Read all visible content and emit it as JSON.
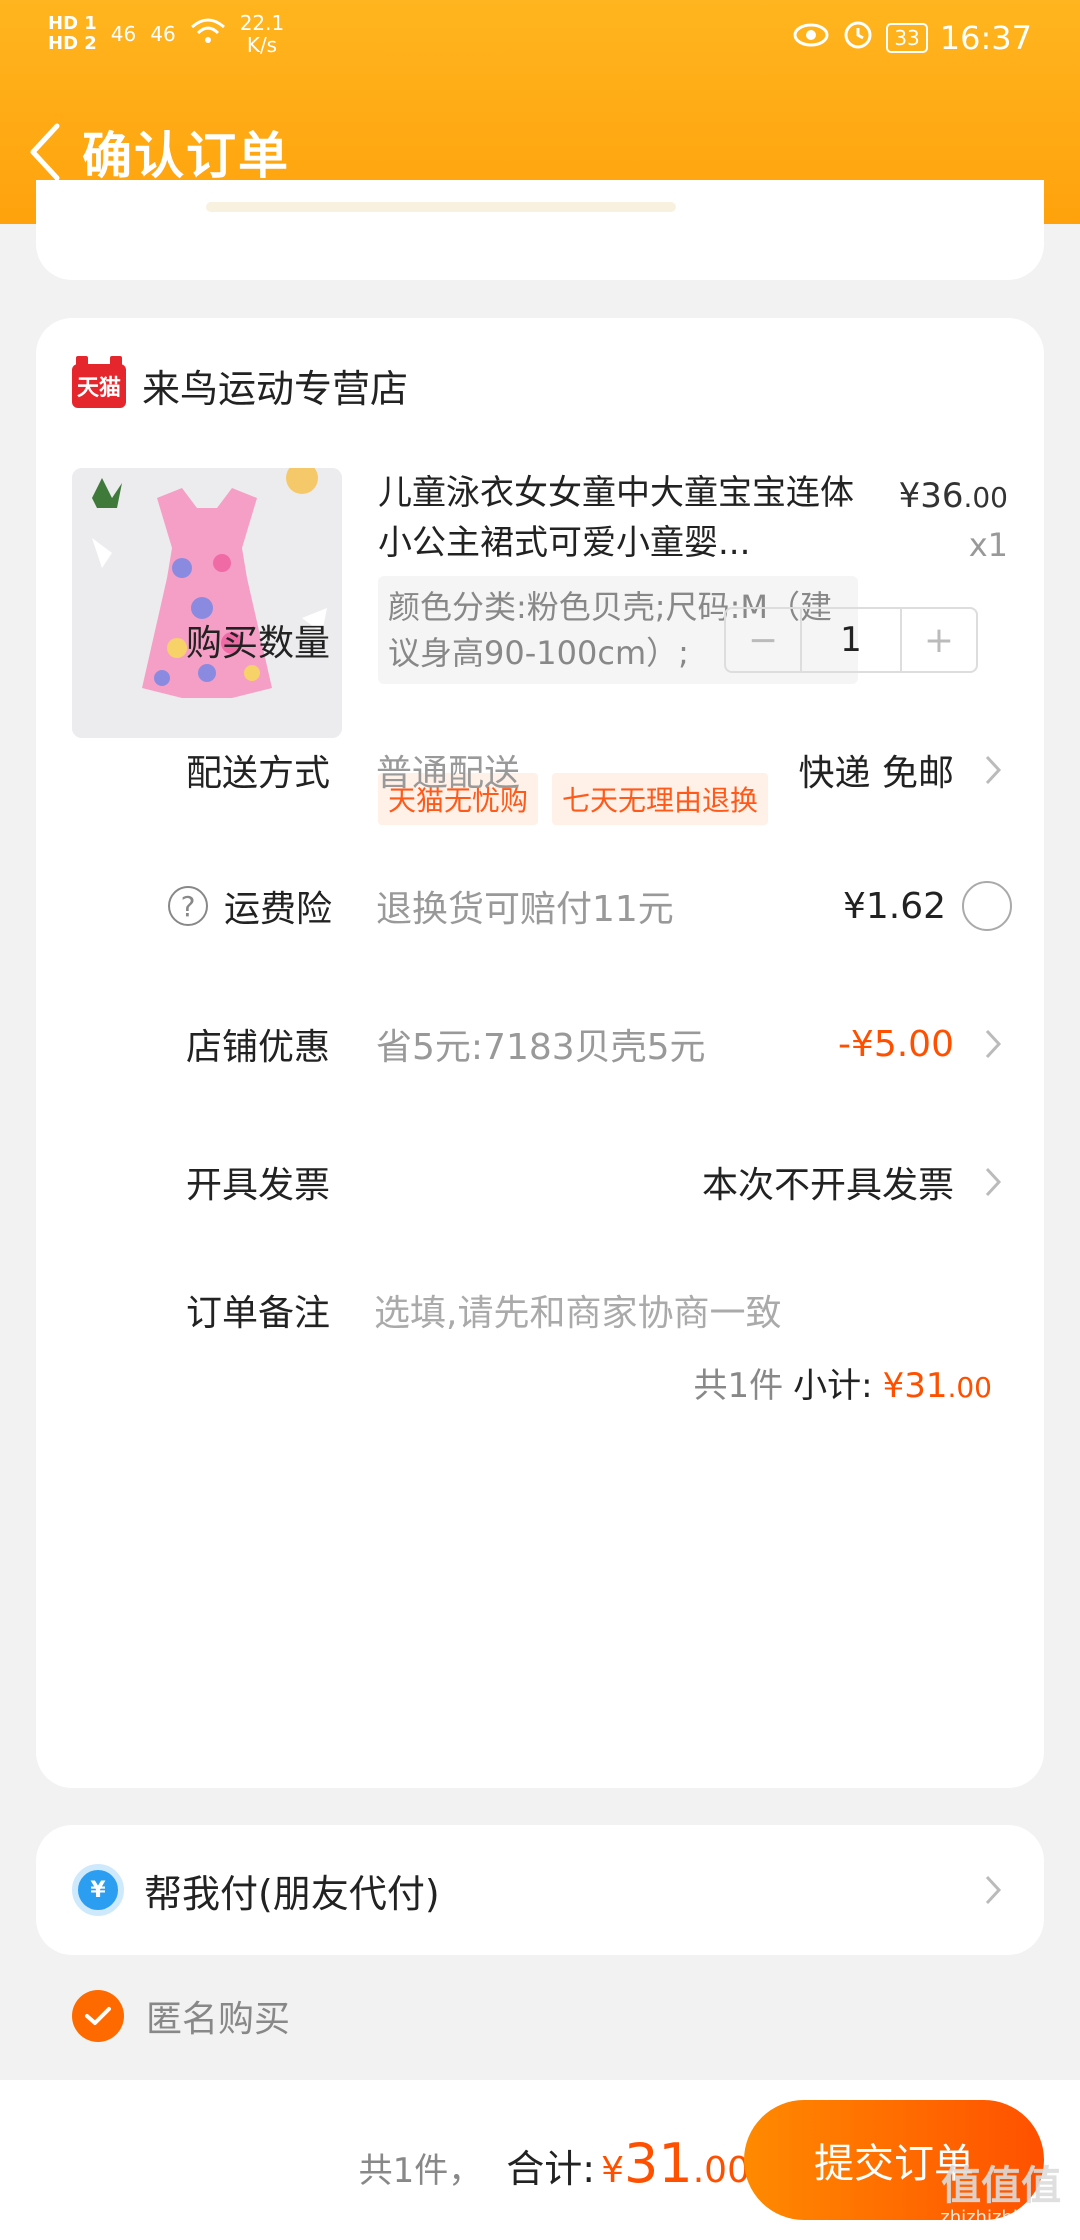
{
  "status_bar": {
    "hd1": "HD 1",
    "hd2": "HD 2",
    "sig1": "46",
    "sig2": "46",
    "speed": "22.1\nK/s",
    "battery": "33",
    "time": "16:37"
  },
  "nav": {
    "title": "确认订单"
  },
  "shop": {
    "logo_text": "天猫",
    "name": "来鸟运动专营店"
  },
  "product": {
    "title": "儿童泳衣女女童中大童宝宝连体小公主裙式可爱小童婴...",
    "price_currency": "¥",
    "price_int": "36",
    "price_dec": ".00",
    "quantity": "x1",
    "sku": "颜色分类:粉色贝壳;尺码:M（建议身高90-100cm）;",
    "tags": [
      "天猫无忧购",
      "七天无理由退换"
    ]
  },
  "rows": {
    "qty_label": "购买数量",
    "qty_minus": "−",
    "qty_value": "1",
    "qty_plus": "+",
    "delivery_label": "配送方式",
    "delivery_sub": "普通配送",
    "delivery_value": "快递 免邮",
    "insurance_label": "运费险",
    "insurance_sub": "退换货可赔付11元",
    "insurance_value": "¥1.62",
    "discount_label": "店铺优惠",
    "discount_sub": "省5元:7183贝壳5元",
    "discount_value": "-¥5.00",
    "invoice_label": "开具发票",
    "invoice_value": "本次不开具发票",
    "note_label": "订单备注",
    "note_placeholder": "选填,请先和商家协商一致"
  },
  "subtotal": {
    "count": "共1件",
    "label": "小计:",
    "currency": "¥",
    "int": "31",
    "dec": ".00"
  },
  "friend_pay": {
    "icon_text": "¥",
    "label": "帮我付(朋友代付)"
  },
  "anonymous": {
    "label": "匿名购买"
  },
  "bottom": {
    "count": "共1件，",
    "label": "合计:",
    "currency": "¥",
    "int": "31",
    "dec": ".00",
    "submit": "提交订单"
  },
  "watermark": {
    "big": "值值值",
    "small": "zhizhizhi.com"
  },
  "colors": {
    "header": "#ffa20c",
    "accent": "#ff5000",
    "tag_bg": "#fff0e8"
  }
}
